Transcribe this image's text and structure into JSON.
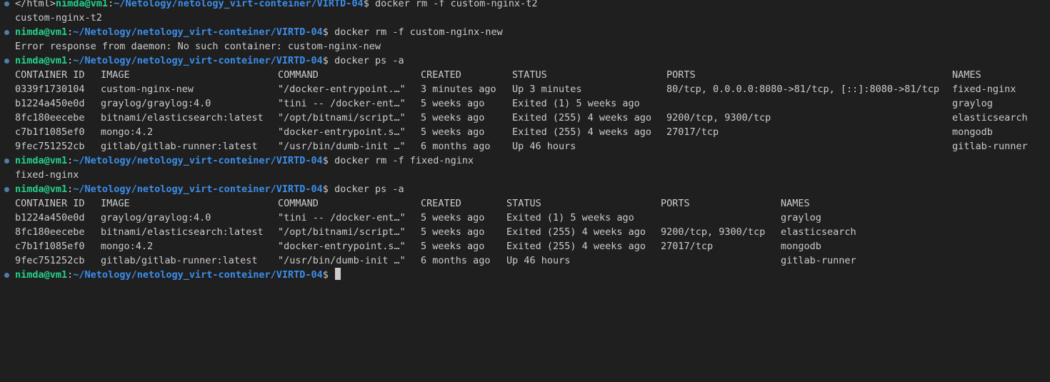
{
  "theme": {
    "background": "#1f1f1f",
    "foreground": "#cccccc",
    "user_color": "#23d18b",
    "path_color": "#3b8eea",
    "marker_color": "#4d7fa8"
  },
  "prompt": {
    "user_host": "nimda@vm1",
    "separator": ":",
    "path": "~/Netology/netology_virt-conteiner/VIRTD-04",
    "symbol": "$ "
  },
  "line0": {
    "prefix": "</html>",
    "command": "docker rm -f custom-nginx-t2"
  },
  "out1": "custom-nginx-t2",
  "cmd2": "docker rm -f custom-nginx-new",
  "out2": "Error response from daemon: No such container: custom-nginx-new",
  "cmd3": "docker ps -a",
  "ps1": {
    "headers": [
      "CONTAINER ID",
      "IMAGE",
      "COMMAND",
      "CREATED",
      "STATUS",
      "PORTS",
      "NAMES"
    ],
    "rows": [
      [
        "0339f1730104",
        "custom-nginx-new",
        "\"/docker-entrypoint.…\"",
        "3 minutes ago",
        "Up 3 minutes",
        "80/tcp, 0.0.0.0:8080->81/tcp, [::]:8080->81/tcp",
        "fixed-nginx"
      ],
      [
        "b1224a450e0d",
        "graylog/graylog:4.0",
        "\"tini -- /docker-ent…\"",
        "5 weeks ago",
        "Exited (1) 5 weeks ago",
        "",
        "graylog"
      ],
      [
        "8fc180eecebe",
        "bitnami/elasticsearch:latest",
        "\"/opt/bitnami/script…\"",
        "5 weeks ago",
        "Exited (255) 4 weeks ago",
        "9200/tcp, 9300/tcp",
        "elasticsearch"
      ],
      [
        "c7b1f1085ef0",
        "mongo:4.2",
        "\"docker-entrypoint.s…\"",
        "5 weeks ago",
        "Exited (255) 4 weeks ago",
        "27017/tcp",
        "mongodb"
      ],
      [
        "9fec751252cb",
        "gitlab/gitlab-runner:latest",
        "\"/usr/bin/dumb-init …\"",
        "6 months ago",
        "Up 46 hours",
        "",
        "gitlab-runner"
      ]
    ]
  },
  "cmd4": "docker rm -f fixed-nginx",
  "out4": "fixed-nginx",
  "cmd5": "docker ps -a",
  "ps2": {
    "headers": [
      "CONTAINER ID",
      "IMAGE",
      "COMMAND",
      "CREATED",
      "STATUS",
      "PORTS",
      "NAMES"
    ],
    "rows": [
      [
        "b1224a450e0d",
        "graylog/graylog:4.0",
        "\"tini -- /docker-ent…\"",
        "5 weeks ago",
        "Exited (1) 5 weeks ago",
        "",
        "graylog"
      ],
      [
        "8fc180eecebe",
        "bitnami/elasticsearch:latest",
        "\"/opt/bitnami/script…\"",
        "5 weeks ago",
        "Exited (255) 4 weeks ago",
        "9200/tcp, 9300/tcp",
        "elasticsearch"
      ],
      [
        "c7b1f1085ef0",
        "mongo:4.2",
        "\"docker-entrypoint.s…\"",
        "5 weeks ago",
        "Exited (255) 4 weeks ago",
        "27017/tcp",
        "mongodb"
      ],
      [
        "9fec751252cb",
        "gitlab/gitlab-runner:latest",
        "\"/usr/bin/dumb-init …\"",
        "6 months ago",
        "Up 46 hours",
        "",
        "gitlab-runner"
      ]
    ]
  }
}
